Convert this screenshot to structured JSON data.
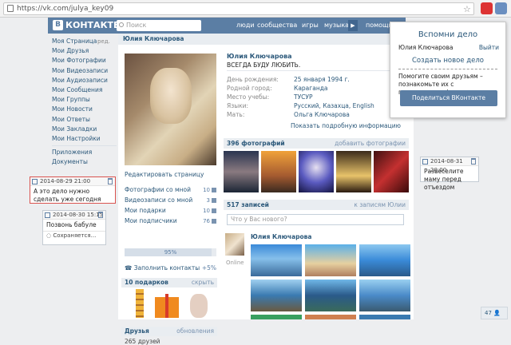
{
  "browser": {
    "url": "https://vk.com/julya_key09"
  },
  "header": {
    "logo": "КОНТАКТЕ",
    "logo_letter": "В",
    "search_placeholder": "Поиск",
    "nav": [
      "люди",
      "сообщества",
      "игры",
      "музыка",
      "помощь"
    ]
  },
  "sidebar": {
    "edit": "ред.",
    "items": [
      "Моя Страница",
      "Мои Друзья",
      "Мои Фотографии",
      "Мои Видеозаписи",
      "Мои Аудиозаписи",
      "Мои Сообщения",
      "Мои Группы",
      "Мои Новости",
      "Мои Ответы",
      "Мои Закладки",
      "Мои Настройки"
    ],
    "items2": [
      "Приложения",
      "Документы"
    ]
  },
  "notes": [
    {
      "date": "2014-08-29 21:00",
      "text": "А это дело нужно сделать уже сегодня"
    },
    {
      "date": "2014-08-30 15:15",
      "text": "Позвонь бабуле",
      "saving": "Сохраняется..."
    },
    {
      "date": "2014-08-31 20:00",
      "text": "Развеселите маму перед отъездом"
    }
  ],
  "profile": {
    "top_name": "Юлия Ключарова",
    "name": "Юлия Ключарова",
    "status": "ВСЕГДА БУДУ ЛЮБИТЬ.",
    "info": [
      {
        "k": "День рождения:",
        "v": "25 января 1994 г."
      },
      {
        "k": "Родной город:",
        "v": "Караганда"
      },
      {
        "k": "Место учебы:",
        "v": "ТУСУР"
      },
      {
        "k": "Языки:",
        "v": "Русский, Казахца, English"
      },
      {
        "k": "Мать:",
        "v": "Ольга Ключарова"
      }
    ],
    "more": "Показать подробную информацию",
    "edit_page": "Редактировать страницу",
    "lists": [
      {
        "label": "Фотографии со мной",
        "n": "10"
      },
      {
        "label": "Видеозаписи со мной",
        "n": "3"
      },
      {
        "label": "Мои подарки",
        "n": "10"
      },
      {
        "label": "Мои подписчики",
        "n": "76"
      }
    ],
    "progress": "95%",
    "progress_value": 95,
    "fill_contacts": "Заполнить контакты",
    "fill_plus": "+5%",
    "gifts_title": "10 подарков",
    "gifts_hide": "скрыть",
    "friends_title": "Друзья",
    "friends_updates": "обновления",
    "friends_count": "265 друзей",
    "photos_title": "396 фотографий",
    "photos_add": "добавить фотографии",
    "wall_title": "517 записей",
    "wall_to": "к записям Юлии",
    "wall_placeholder": "Что у Вас нового?",
    "post_name": "Юлия Ключарова",
    "online": "Online"
  },
  "popup": {
    "title": "Вспомни дело",
    "user": "Юлия Ключарова",
    "exit": "Выйти",
    "new": "Создать новое дело",
    "help": "Помогите своим друзьям – познакомьте их с приложением :)",
    "share": "Поделиться ВКонтакте"
  },
  "counter": "47",
  "colors": {
    "brand": "#5b7ea4",
    "link": "#2b587a",
    "bg": "#edeef0"
  }
}
